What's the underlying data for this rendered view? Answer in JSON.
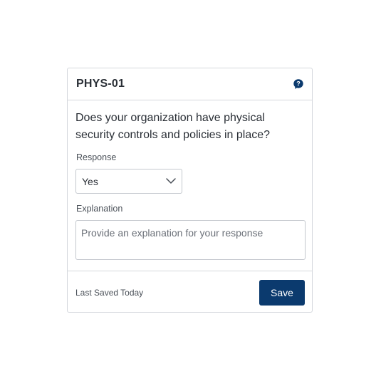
{
  "card": {
    "control_id": "PHYS-01",
    "help_icon": "question-mark-icon",
    "question": "Does your organization have physical security controls and policies in place?",
    "response": {
      "label": "Response",
      "selected_value": "Yes",
      "icon": "chevron-down-icon"
    },
    "explanation": {
      "label": "Explanation",
      "value": "",
      "placeholder": "Provide an explanation for your response"
    },
    "footer": {
      "status": "Last Saved Today",
      "save_label": "Save"
    }
  },
  "colors": {
    "accent": "#0b3a6e",
    "border": "#d4d7dc",
    "text": "#2a2f36"
  }
}
